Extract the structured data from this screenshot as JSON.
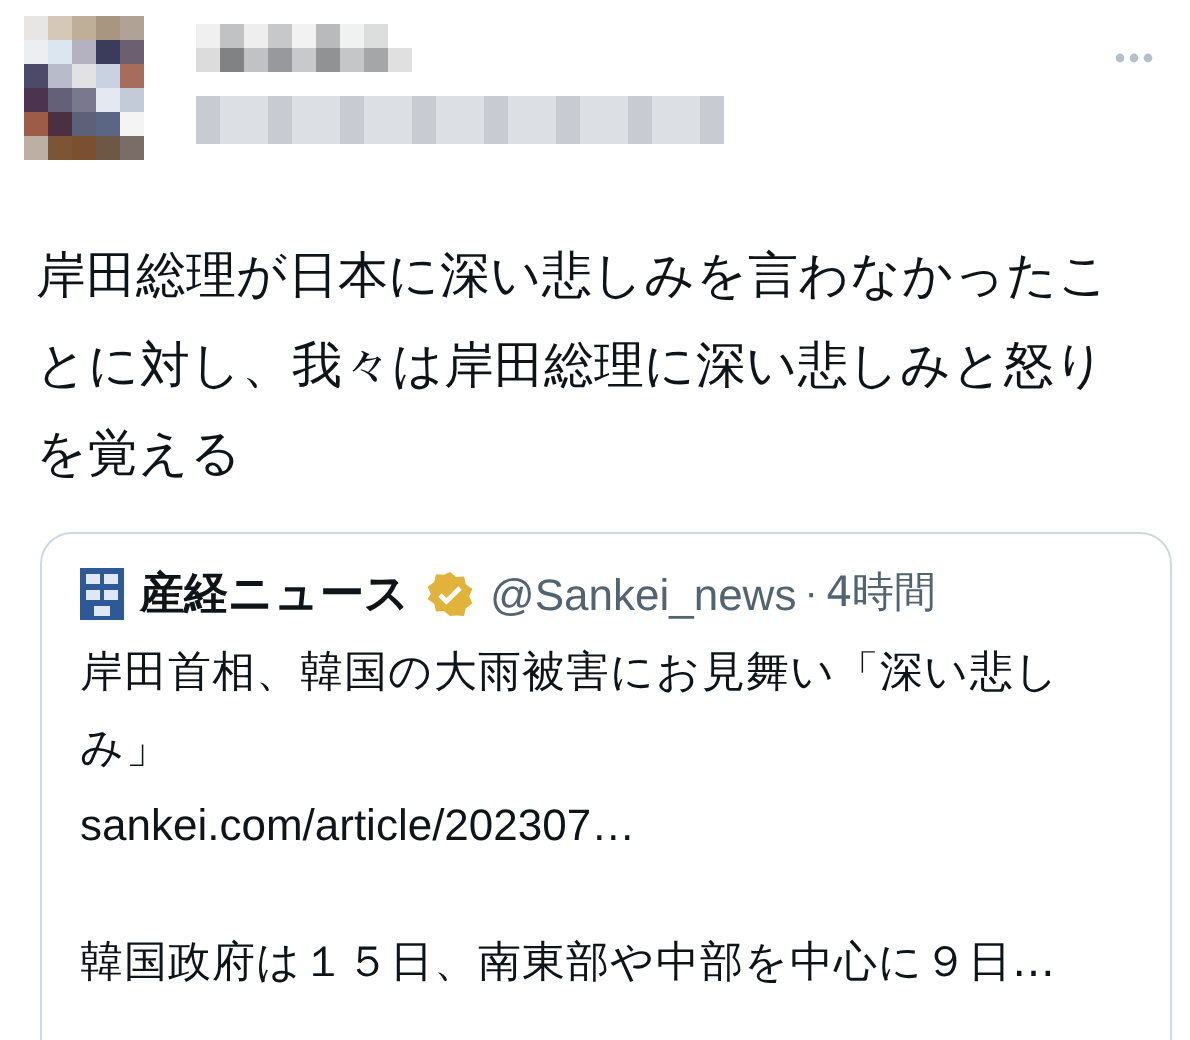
{
  "tweet": {
    "text": "岸田総理が日本に深い悲しみを言わなかったことに対し、我々は岸田総理に深い悲しみと怒りを覚える"
  },
  "quote": {
    "name": "産経ニュース",
    "verified": true,
    "handle": "@Sankei_news",
    "separator": "·",
    "time": "4時間",
    "title": "岸田首相、韓国の大雨被害にお見舞い「深い悲しみ」",
    "link": "sankei.com/article/202307…",
    "summary": "韓国政府は１５日、南東部や中部を中心に９日…"
  }
}
